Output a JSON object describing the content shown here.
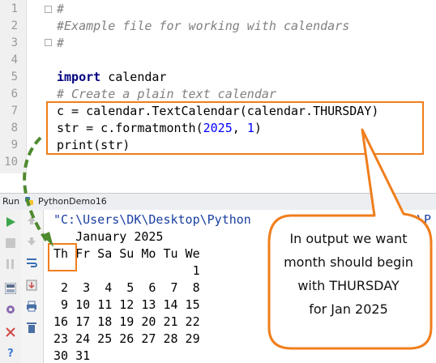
{
  "editor": {
    "line_numbers": [
      "1",
      "2",
      "3",
      "4",
      "5",
      "6",
      "7",
      "8",
      "9",
      "10"
    ],
    "lines": {
      "l1": "#",
      "l2": "#Example file for working with calendars",
      "l3": "#",
      "l5_kw": "import",
      "l5_rest": " calendar",
      "l6": "# Create a plain text calendar",
      "l7": "c = calendar.TextCalendar(calendar.THURSDAY)",
      "l8_a": "str = c.formatmonth(",
      "l8_n1": "2025",
      "l8_b": ", ",
      "l8_n2": "1",
      "l8_c": ")",
      "l9": "print(str)"
    }
  },
  "run_panel": {
    "tab_label": "Run",
    "config_name": "PythonDemo16",
    "command": "\"C:\\Users\\DK\\Desktop\\Python",
    "command_tail": "\\P",
    "output_lines": [
      "   January 2025",
      "Th Fr Sa Su Mo Tu We",
      "                   1",
      " 2  3  4  5  6  7  8",
      " 9 10 11 12 13 14 15",
      "16 17 18 19 20 21 22",
      "23 24 25 26 27 28 29",
      "30 31"
    ]
  },
  "callout": {
    "lines": [
      "In output we want",
      "month should begin",
      "with THURSDAY",
      "for Jan 2025"
    ]
  },
  "colors": {
    "highlight_orange": "#f07e1c",
    "arrow_green": "#4f8a2f"
  }
}
